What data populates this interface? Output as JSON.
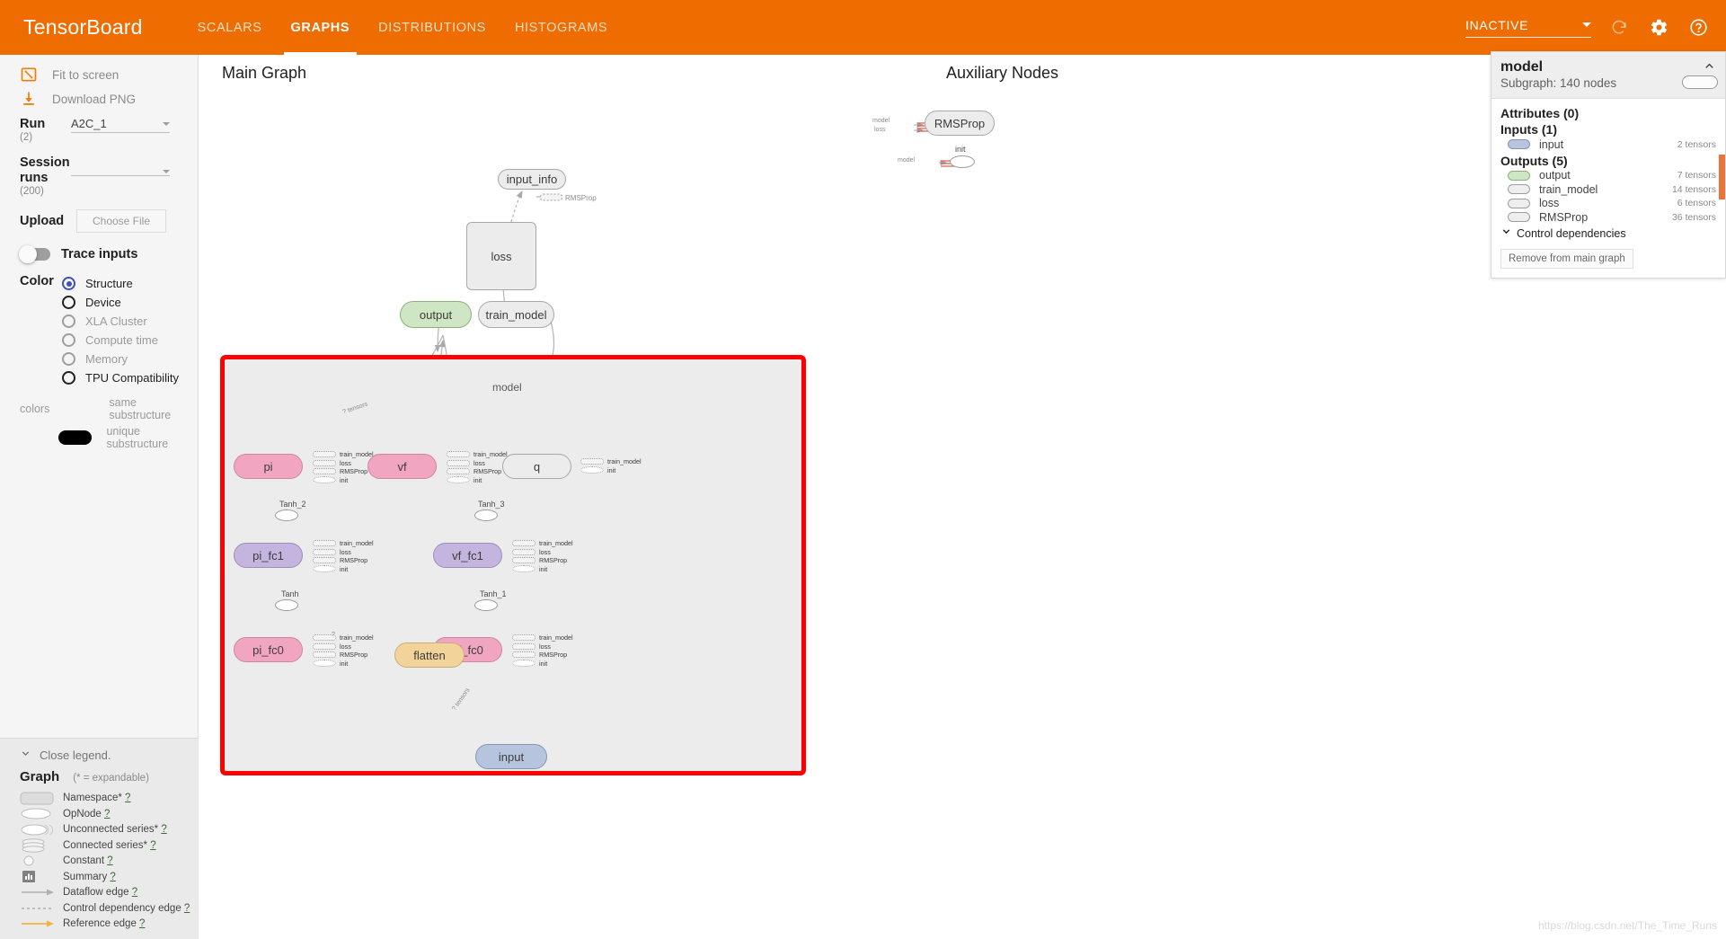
{
  "header": {
    "brand": "TensorBoard",
    "tabs": [
      {
        "label": "SCALARS",
        "active": false
      },
      {
        "label": "GRAPHS",
        "active": true
      },
      {
        "label": "DISTRIBUTIONS",
        "active": false
      },
      {
        "label": "HISTOGRAMS",
        "active": false
      }
    ],
    "status_value": "INACTIVE",
    "accent_color": "#ef6c00",
    "icons": [
      "refresh-icon",
      "gear-icon",
      "help-icon"
    ]
  },
  "sidebar": {
    "fit_to_screen": "Fit to screen",
    "download_png": "Download PNG",
    "run_label": "Run",
    "run_count": "(2)",
    "run_value": "A2C_1",
    "session_runs_label": "Session runs",
    "session_runs_count": "(200)",
    "session_runs_value": "",
    "upload_label": "Upload",
    "choose_file": "Choose File",
    "trace_inputs": "Trace inputs",
    "color_label": "Color",
    "color_options": [
      {
        "label": "Structure",
        "state": "selected"
      },
      {
        "label": "Device",
        "state": "enabled"
      },
      {
        "label": "XLA Cluster",
        "state": "disabled"
      },
      {
        "label": "Compute time",
        "state": "disabled"
      },
      {
        "label": "Memory",
        "state": "disabled"
      },
      {
        "label": "TPU Compatibility",
        "state": "enabled"
      }
    ],
    "colors_key": "colors",
    "same_substructure": "same substructure",
    "unique_substructure": "unique substructure",
    "unique_color": "#000000",
    "selected_radio_color": "#3f51b5"
  },
  "legend": {
    "close_label": "Close legend.",
    "title": "Graph",
    "subtitle": "(* = expandable)",
    "items": [
      {
        "glyph": "namespace-glyph",
        "label": "Namespace*",
        "help": "?"
      },
      {
        "glyph": "opnode-glyph",
        "label": "OpNode",
        "help": "?"
      },
      {
        "glyph": "unconnected-series-glyph",
        "label": "Unconnected series*",
        "help": "?"
      },
      {
        "glyph": "connected-series-glyph",
        "label": "Connected series*",
        "help": "?"
      },
      {
        "glyph": "constant-glyph",
        "label": "Constant",
        "help": "?"
      },
      {
        "glyph": "summary-glyph",
        "label": "Summary",
        "help": "?"
      },
      {
        "glyph": "dataflow-edge-glyph",
        "label": "Dataflow edge",
        "help": "?"
      },
      {
        "glyph": "control-dependency-edge-glyph",
        "label": "Control dependency edge",
        "help": "?"
      },
      {
        "glyph": "reference-edge-glyph",
        "label": "Reference edge",
        "help": "?"
      }
    ]
  },
  "graph": {
    "main_title": "Main Graph",
    "aux_title": "Auxiliary Nodes",
    "subgraph_label": "model",
    "nodes": {
      "input_info": "input_info",
      "loss": "loss",
      "output": "output",
      "train_model": "train_model",
      "rmsprop_edge": "RMSProp",
      "pi": "pi",
      "vf": "vf",
      "q": "q",
      "pi_fc1": "pi_fc1",
      "vf_fc1": "vf_fc1",
      "pi_fc0": "pi_fc0",
      "vf_fc0": "vf_fc0",
      "flatten": "flatten",
      "input": "input"
    },
    "op_labels": {
      "tanh": "Tanh",
      "tanh_1": "Tanh_1",
      "tanh_2": "Tanh_2",
      "tanh_3": "Tanh_3"
    },
    "annotations": [
      "train_model",
      "loss",
      "RMSProp",
      "init"
    ],
    "q_annotations": [
      "train_model",
      "init"
    ],
    "edge_labels": {
      "tensors_forward": "? tensors",
      "flatten_edge": "?",
      "input_edge": "? tensors"
    },
    "aux": {
      "rmsprop_node": "RMSProp",
      "init_node": "init",
      "model_label_1": "model",
      "loss_label": "loss",
      "model_label_2": "model"
    },
    "highlight_color": "#ff0000"
  },
  "info_panel": {
    "title": "model",
    "subtitle": "Subgraph: 140 nodes",
    "attributes_header": "Attributes (0)",
    "inputs_header": "Inputs (1)",
    "inputs": [
      {
        "name": "input",
        "count": "2 tensors",
        "color": "blue"
      }
    ],
    "outputs_header": "Outputs (5)",
    "outputs": [
      {
        "name": "output",
        "count": "7 tensors",
        "color": "green"
      },
      {
        "name": "train_model",
        "count": "14 tensors",
        "color": "grey"
      },
      {
        "name": "loss",
        "count": "6 tensors",
        "color": "grey"
      },
      {
        "name": "RMSProp",
        "count": "36 tensors",
        "color": "grey"
      }
    ],
    "control_dependencies": "Control dependencies",
    "remove_button": "Remove from main graph",
    "bar_color": "#e8743b"
  },
  "watermark": "https://blog.csdn.net/The_Time_Runs"
}
